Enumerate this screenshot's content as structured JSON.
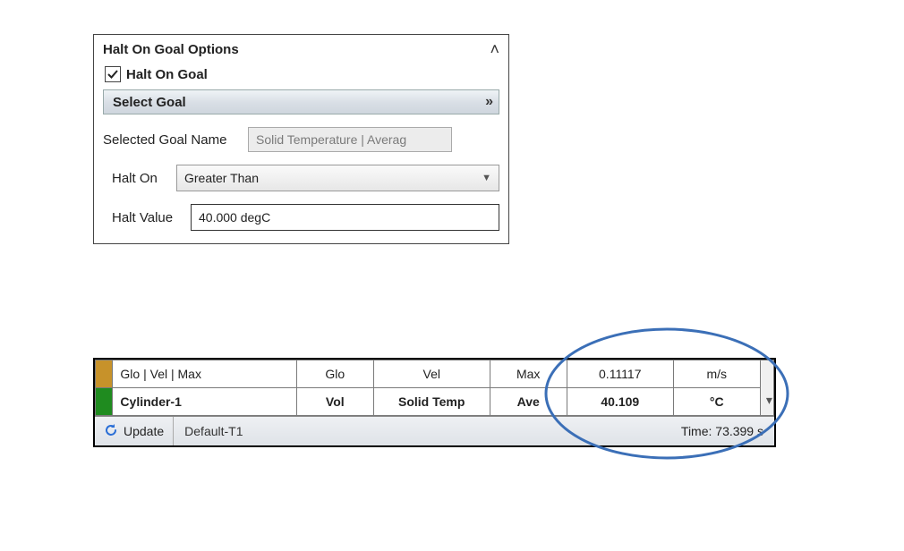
{
  "panel": {
    "title": "Halt On Goal Options",
    "checkbox_label": "Halt On Goal",
    "checkbox_checked": true,
    "select_goal_label": "Select Goal",
    "selected_goal_name_label": "Selected Goal Name",
    "selected_goal_name_value": "Solid Temperature | Averag",
    "halt_on_label": "Halt On",
    "halt_on_value": "Greater Than",
    "halt_value_label": "Halt Value",
    "halt_value_value": "40.000 degC"
  },
  "table": {
    "rows": [
      {
        "color": "#c7922a",
        "name": "Glo | Vel | Max",
        "c1": "Glo",
        "c2": "Vel",
        "c3": "Max",
        "value": "0.11117",
        "unit": "m/s",
        "bold": false
      },
      {
        "color": "#1f8b1f",
        "name": "Cylinder-1",
        "c1": "Vol",
        "c2": "Solid Temp",
        "c3": "Ave",
        "value": "40.109",
        "unit": "°C",
        "bold": true
      }
    ],
    "footer": {
      "update_label": "Update",
      "scenario": "Default-T1",
      "time_label": "Time: 73.399 s"
    }
  }
}
